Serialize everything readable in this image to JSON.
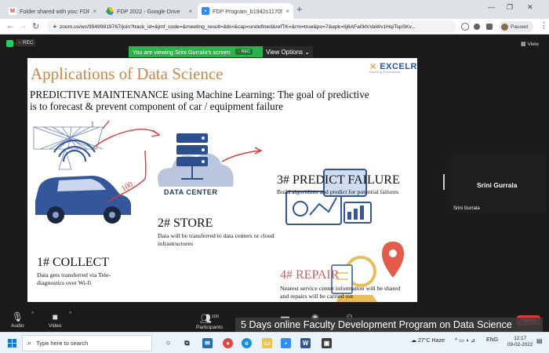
{
  "browser": {
    "tabs": [
      {
        "title": "Folder shared with you: FDP 202",
        "icon": "gmail-icon",
        "active": false
      },
      {
        "title": "FDP 2022 - Google Drive",
        "icon": "google-drive-icon",
        "active": false
      },
      {
        "title": "FDP Program_b1942s11705",
        "icon": "zoom-icon",
        "active": true
      }
    ],
    "new_tab": "+",
    "address": "zoom.us/wc/99499819767/join?track_id=&jmf_code=&meeting_result=&tk=&cap=undefined&refTK=&rm=true&po=7&epk=Iij6AFa0kfcVaWv1HqiTspSKv...",
    "profile_status": "Paused"
  },
  "zoom": {
    "rec_label": "REC",
    "view_label": "View",
    "share_banner": "You are viewing Srini Gurrala's screen",
    "banner_rec": "REC",
    "view_options": "View Options",
    "participant_name": "Srini Gurrala",
    "participant_label": "Srini Gurrala",
    "controls": {
      "audio": "Audio",
      "video": "Video",
      "participants": "Participants",
      "participant_count": "100",
      "leave": "Leave"
    },
    "caption": "5 Days online Faculty Development Program on Data Science"
  },
  "slide": {
    "title": "Applications of Data Science",
    "logo": "EXCELR",
    "logo_sub": "Ranking Excellence",
    "line1": "PREDICTIVE MAINTENANCE using Machine Learning: The goal of predictive",
    "line2": "is to forecast & prevent component of car / equipment failure",
    "data_center": "DATA CENTER",
    "sections": [
      {
        "title": "1# COLLECT",
        "desc": "Data gets transferred via Tele-diagnostics over Wi-fi"
      },
      {
        "title": "2# STORE",
        "desc": "Data will be transferred to data centers or cloud infrastructures"
      },
      {
        "title": "3# PREDICT FAILURE",
        "desc": "Build algorithms and predict for potential failures"
      },
      {
        "title": "4# REPAIR",
        "desc": "Nearest service center information will be shared and repairs will be carried out"
      }
    ],
    "annotations": [
      "1",
      "100"
    ]
  },
  "taskbar": {
    "search_placeholder": "Type here to search",
    "weather": "27°C Haze",
    "language": "ENG",
    "time": "12:17",
    "date": "09-02-2022"
  }
}
